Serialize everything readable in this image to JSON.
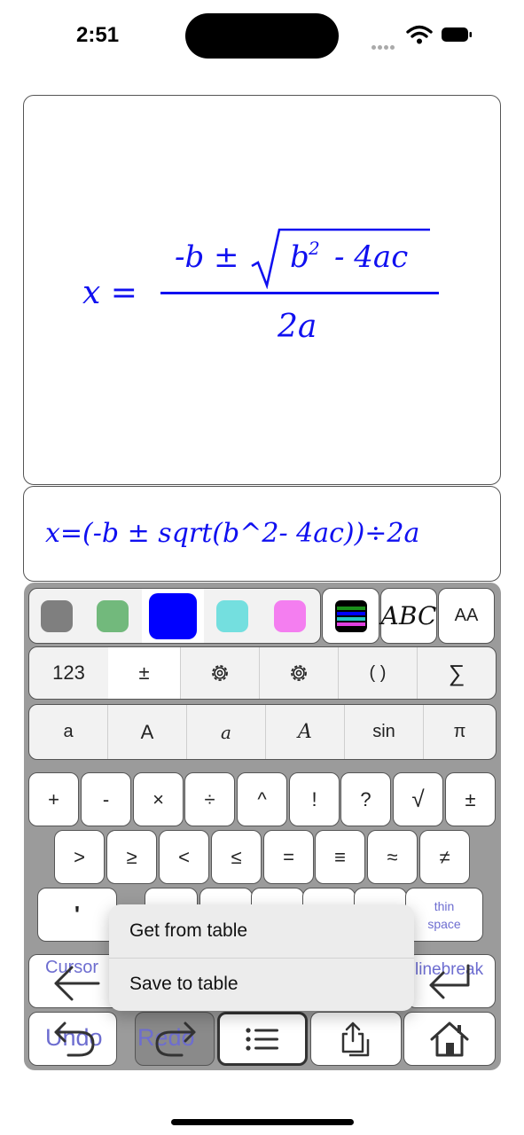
{
  "status_bar": {
    "time": "2:51"
  },
  "preview": {
    "lhs": "x =",
    "numerator_prefix": "-b ±",
    "radicand_base": "b",
    "radicand_exp": "2",
    "radicand_rest": "- 4ac",
    "denominator": "2a"
  },
  "text_field": {
    "value": "x=(-b ± sqrt(b^2- 4ac))÷2a"
  },
  "colors": {
    "swatches": [
      "#7f7f7f",
      "#72b97c",
      "#0000ff",
      "#74dfdf",
      "#f47ef0"
    ],
    "selected_index": 2
  },
  "style_row": {
    "abc": "ABC",
    "size": "AA"
  },
  "mode_row": [
    "123",
    "±",
    "gear-icon",
    "gear-icon",
    "( )",
    "∑"
  ],
  "font_row": [
    "a",
    "A",
    "a",
    "A",
    "sin",
    "π"
  ],
  "ops_row1": [
    "+",
    "-",
    "×",
    "÷",
    "^",
    "!",
    "?",
    "√",
    "±"
  ],
  "ops_row2": [
    ">",
    "≥",
    "<",
    "≤",
    "=",
    "≡",
    "≈",
    "≠"
  ],
  "ops_row3": {
    "first": "'",
    "thin_space": [
      "thin",
      "space"
    ]
  },
  "nav": {
    "cursor": "Cursor",
    "linebreak": "linebreak",
    "undo": "Undo",
    "redo": "Redo"
  },
  "menu": {
    "get_from_table": "Get from table",
    "save_to_table": "Save to table"
  }
}
